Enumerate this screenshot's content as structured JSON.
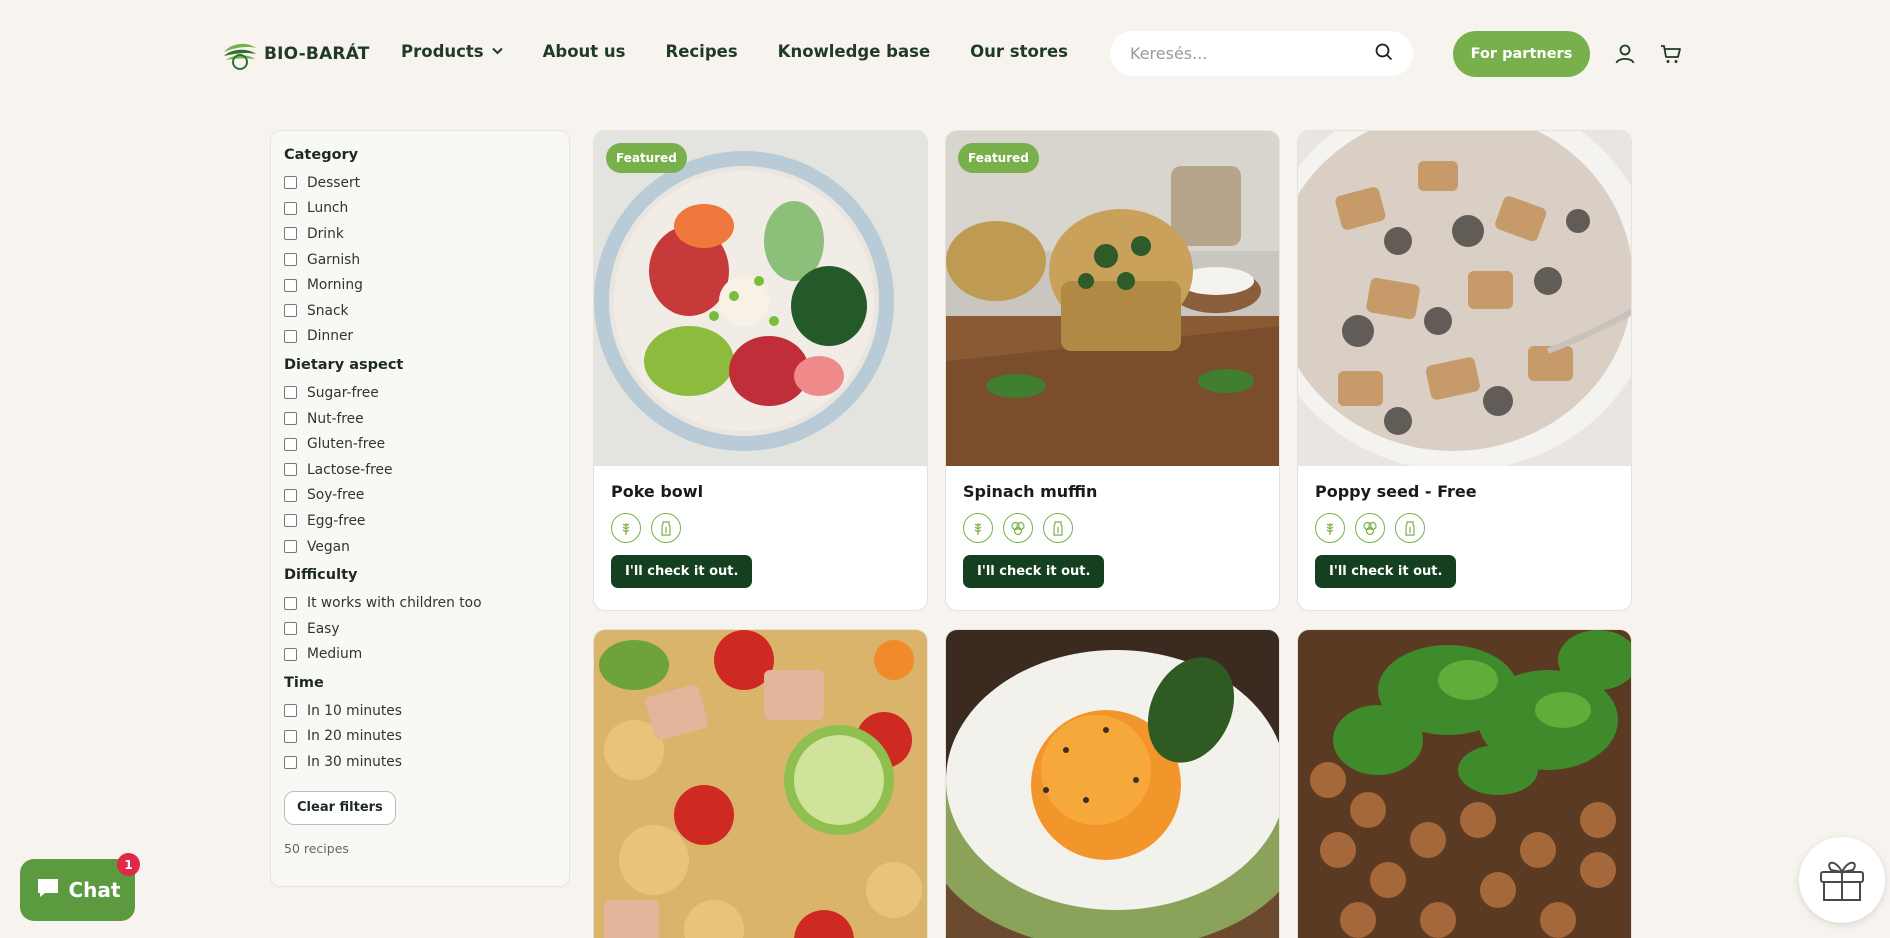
{
  "header": {
    "logo_text": "BIO-BARÁT",
    "nav": [
      {
        "label": "Products",
        "has_dropdown": true
      },
      {
        "label": "About us"
      },
      {
        "label": "Recipes"
      },
      {
        "label": "Knowledge base"
      },
      {
        "label": "Our stores"
      }
    ],
    "search_placeholder": "Keresés...",
    "partners_label": "For partners",
    "icons": [
      "search-icon",
      "account-icon",
      "cart-icon"
    ]
  },
  "filters": {
    "sections": [
      {
        "title": "Category",
        "options": [
          "Dessert",
          "Lunch",
          "Drink",
          "Garnish",
          "Morning",
          "Snack",
          "Dinner"
        ]
      },
      {
        "title": "Dietary aspect",
        "options": [
          "Sugar-free",
          "Nut-free",
          "Gluten-free",
          "Lactose-free",
          "Soy-free",
          "Egg-free",
          "Vegan"
        ]
      },
      {
        "title": "Difficulty",
        "options": [
          "It works with children too",
          "Easy",
          "Medium"
        ]
      },
      {
        "title": "Time",
        "options": [
          "In 10 minutes",
          "In 20 minutes",
          "In 30 minutes"
        ]
      }
    ],
    "clear_label": "Clear filters",
    "count_text": "50 recipes"
  },
  "recipes": [
    {
      "title": "Poke bowl",
      "badge": "Featured",
      "icons": [
        "gluten-free-icon",
        "lactose-free-icon"
      ],
      "cta": "I'll check it out."
    },
    {
      "title": "Spinach muffin",
      "badge": "Featured",
      "icons": [
        "gluten-free-icon",
        "nut-free-icon",
        "lactose-free-icon"
      ],
      "cta": "I'll check it out."
    },
    {
      "title": "Poppy seed - Free",
      "badge": "",
      "icons": [
        "gluten-free-icon",
        "nut-free-icon",
        "lactose-free-icon"
      ],
      "cta": "I'll check it out."
    },
    {
      "title": "",
      "badge": "",
      "icons": [],
      "cta": ""
    },
    {
      "title": "",
      "badge": "",
      "icons": [],
      "cta": ""
    },
    {
      "title": "",
      "badge": "",
      "icons": [],
      "cta": ""
    }
  ],
  "chat": {
    "label": "Chat",
    "unread": "1"
  },
  "colors": {
    "accent": "#78b04c",
    "dark_green": "#14401f",
    "background": "#f7f3ef"
  }
}
